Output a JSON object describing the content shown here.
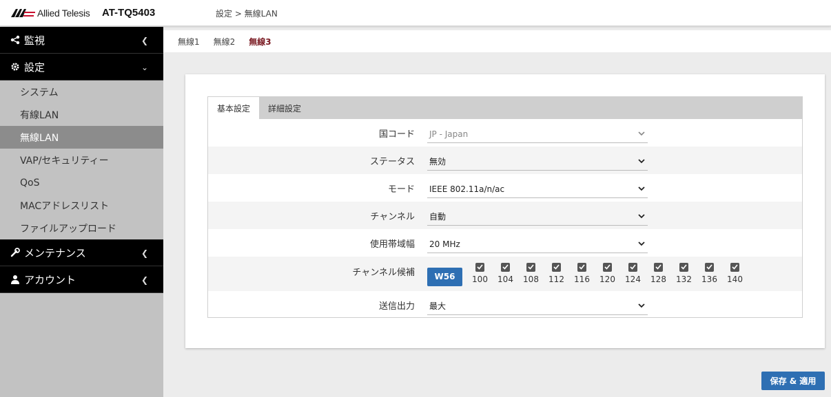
{
  "header": {
    "brand": "Allied Telesis",
    "model": "AT-TQ5403",
    "breadcrumb": "設定 > 無線LAN"
  },
  "sidebar": {
    "groups": [
      {
        "label": "監視",
        "icon": "share-icon",
        "state": "collapsed"
      },
      {
        "label": "設定",
        "icon": "gear-icon",
        "state": "expanded"
      },
      {
        "label": "メンテナンス",
        "icon": "wrench-icon",
        "state": "collapsed"
      },
      {
        "label": "アカウント",
        "icon": "user-icon",
        "state": "collapsed"
      }
    ],
    "items": [
      {
        "label": "システム"
      },
      {
        "label": "有線LAN"
      },
      {
        "label": "無線LAN",
        "active": true
      },
      {
        "label": "VAP/セキュリティー"
      },
      {
        "label": "QoS"
      },
      {
        "label": "MACアドレスリスト"
      },
      {
        "label": "ファイルアップロード"
      }
    ]
  },
  "tabs": [
    "無線1",
    "無線2",
    "無線3"
  ],
  "active_tab": "無線3",
  "subtabs": [
    "基本設定",
    "詳細設定"
  ],
  "active_subtab": "基本設定",
  "form": {
    "country": {
      "label": "国コード",
      "value": "JP - Japan",
      "disabled": true
    },
    "status": {
      "label": "ステータス",
      "value": "無効"
    },
    "mode": {
      "label": "モード",
      "value": "IEEE 802.11a/n/ac"
    },
    "channel": {
      "label": "チャンネル",
      "value": "自動"
    },
    "bandwidth": {
      "label": "使用帯域幅",
      "value": "20 MHz"
    },
    "candidates": {
      "label": "チャンネル候補",
      "group_button": "W56",
      "channels": [
        "100",
        "104",
        "108",
        "112",
        "116",
        "120",
        "124",
        "128",
        "132",
        "136",
        "140"
      ],
      "checked": true
    },
    "tx_power": {
      "label": "送信出力",
      "value": "最大"
    }
  },
  "save_label": "保存 & 適用",
  "colors": {
    "accent": "#2e6fb3",
    "active_tab": "#7a1a22",
    "sidebar_bg": "#c2c2c2",
    "nav_dark": "#000000"
  }
}
